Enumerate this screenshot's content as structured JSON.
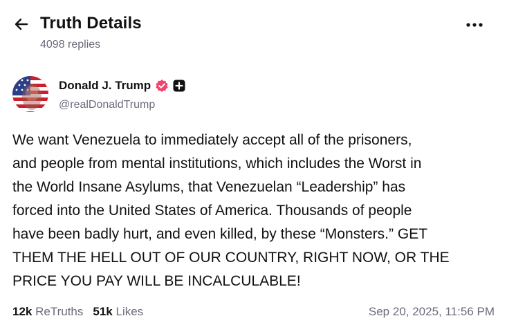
{
  "header": {
    "title": "Truth Details",
    "replies": "4098 replies",
    "back_icon": "arrow-left-icon",
    "more_icon": "more-horizontal-icon"
  },
  "author": {
    "display_name": "Donald J. Trump",
    "handle": "@realDonaldTrump",
    "verified_color": "#f0446c",
    "badge_icon": "plus-badge-icon"
  },
  "post": {
    "text": "We want Venezuela to immediately accept all of the prisoners,\nand people from mental institutions, which includes the Worst in\nthe World Insane Asylums, that Venezuelan “Leadership” has\nforced into the United States of America. Thousands of people\nhave been badly hurt, and even killed, by these “Monsters.” GET\nTHEM THE HELL OUT OF OUR COUNTRY, RIGHT NOW, OR THE\nPRICE YOU PAY WILL BE INCALCULABLE!"
  },
  "stats": {
    "retruths_count": "12k",
    "retruths_label": "ReTruths",
    "likes_count": "51k",
    "likes_label": "Likes"
  },
  "timestamp": "Sep 20, 2025, 11:56 PM"
}
